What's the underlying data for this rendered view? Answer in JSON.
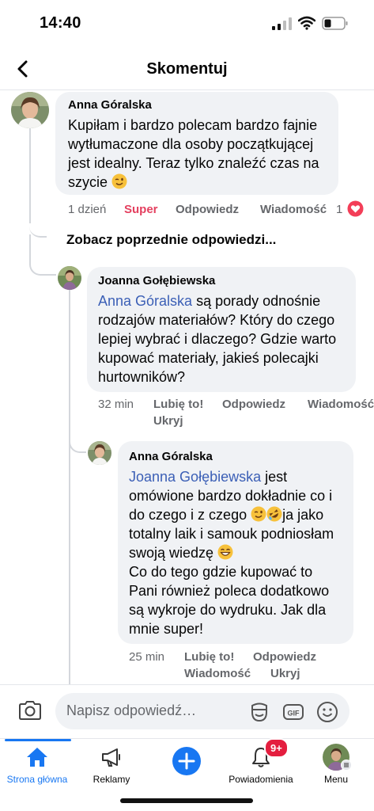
{
  "status_bar": {
    "time": "14:40"
  },
  "header": {
    "title": "Skomentuj"
  },
  "comment1": {
    "author": "Anna Góralska",
    "lines": [
      "Kupiłam i bardzo polecam bardzo fajnie",
      "wytłumaczone dla osoby początkującej",
      "jest idealny. Teraz tylko znaleźć czas na",
      "szycie"
    ],
    "time": "1 dzień",
    "reaction": "Super",
    "reply": "Odpowiedz",
    "message": "Wiadomość",
    "likes": "1"
  },
  "see_previous": "Zobacz poprzednie odpowiedzi...",
  "comment2": {
    "author": "Joanna Gołębiewska",
    "mention": "Anna Góralska",
    "first_line_rest": " są porady odnośnie",
    "lines": [
      "rodzajów materiałów? Który do czego",
      "lepiej wybrać i dlaczego? Gdzie warto",
      "kupować materiały, jakieś polecajki",
      "hurtowników?"
    ],
    "time": "32 min",
    "like": "Lubię to!",
    "reply": "Odpowiedz",
    "message": "Wiadomość",
    "hide": "Ukryj"
  },
  "comment3": {
    "author": "Anna Góralska",
    "mention": "Joanna Gołębiewska",
    "first_line_rest": " jest",
    "line2": "omówione bardzo dokładnie co i",
    "line3": "do czego i z czego",
    "line3_rest": "ja jako",
    "line4": "totalny laik i samouk podniosłam",
    "line5": "swoją wiedzę",
    "lines": [
      "Co do tego gdzie kupować to",
      "Pani również poleca dodatkowo",
      "są wykroje do wydruku. Jak dla",
      "mnie super!"
    ],
    "time": "25 min",
    "like": "Lubię to!",
    "reply": "Odpowiedz",
    "message": "Wiadomość",
    "hide": "Ukryj"
  },
  "compose": {
    "placeholder": "Napisz odpowiedź…",
    "gif": "GIF"
  },
  "tabs": [
    {
      "label": "Strona główna"
    },
    {
      "label": "Reklamy"
    },
    {
      "label": ""
    },
    {
      "label": "Powiadomienia"
    },
    {
      "label": "Menu"
    }
  ],
  "notification_badge": "9+",
  "colors": {
    "accent": "#1877f2",
    "mention": "#3b5fb6",
    "super": "#e4405f",
    "badge": "#e41e3f",
    "bubble": "#f0f2f5"
  }
}
